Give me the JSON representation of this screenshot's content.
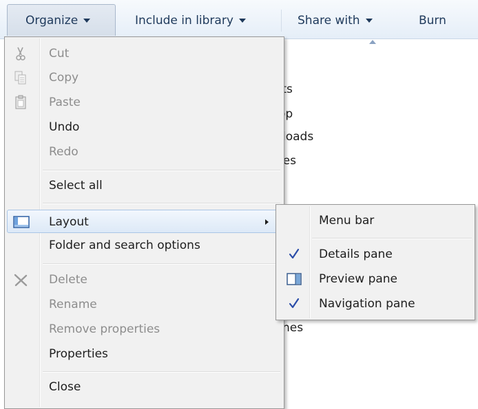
{
  "toolbar": {
    "organize": "Organize",
    "include_in_library": "Include in library",
    "share_with": "Share with",
    "burn": "Burn"
  },
  "background_items": [
    "cts",
    "op",
    "loads",
    "tes",
    "nes"
  ],
  "menu": {
    "cut": "Cut",
    "copy": "Copy",
    "paste": "Paste",
    "undo": "Undo",
    "redo": "Redo",
    "select_all": "Select all",
    "layout": "Layout",
    "folder_options": "Folder and search options",
    "delete": "Delete",
    "rename": "Rename",
    "remove_properties": "Remove properties",
    "properties": "Properties",
    "close": "Close"
  },
  "layout_submenu": {
    "menu_bar": "Menu bar",
    "details_pane": "Details pane",
    "preview_pane": "Preview pane",
    "navigation_pane": "Navigation pane",
    "checked": [
      "Details pane",
      "Navigation pane"
    ]
  },
  "colors": {
    "toolbar_text": "#1e395b",
    "disabled_text": "#8d8d8d",
    "check": "#2a4ca8"
  }
}
